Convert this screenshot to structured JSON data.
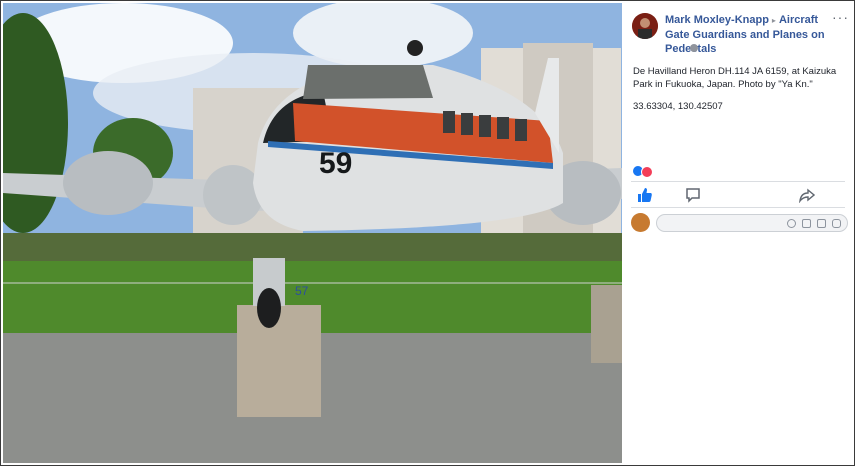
{
  "post": {
    "author": "Mark Moxley-Knapp",
    "group": "Aircraft Gate Guardians and Planes on Pedestals",
    "separator": "▸",
    "caption": "De Havilland Heron DH.114 JA 6159, at Kaizuka Park in Fukuoka, Japan. Photo by \"Ya Kn.\"",
    "coordinates": "33.63304, 130.42507",
    "more_label": "···"
  },
  "photo": {
    "tail_number": "59",
    "gear_number": "57"
  },
  "colors": {
    "link": "#365899",
    "like": "#1877f2",
    "love": "#f33e58",
    "stripe_orange": "#d2522a",
    "stripe_blue": "#2f6fb5"
  },
  "icons": {
    "privacy": "globe-icon",
    "like_action": "thumbs-up-icon",
    "comment_action": "speech-bubble-icon",
    "share_action": "share-arrow-icon",
    "emoji": "smiley-icon",
    "camera": "camera-icon",
    "gif": "gif-icon",
    "sticker": "sticker-icon"
  }
}
